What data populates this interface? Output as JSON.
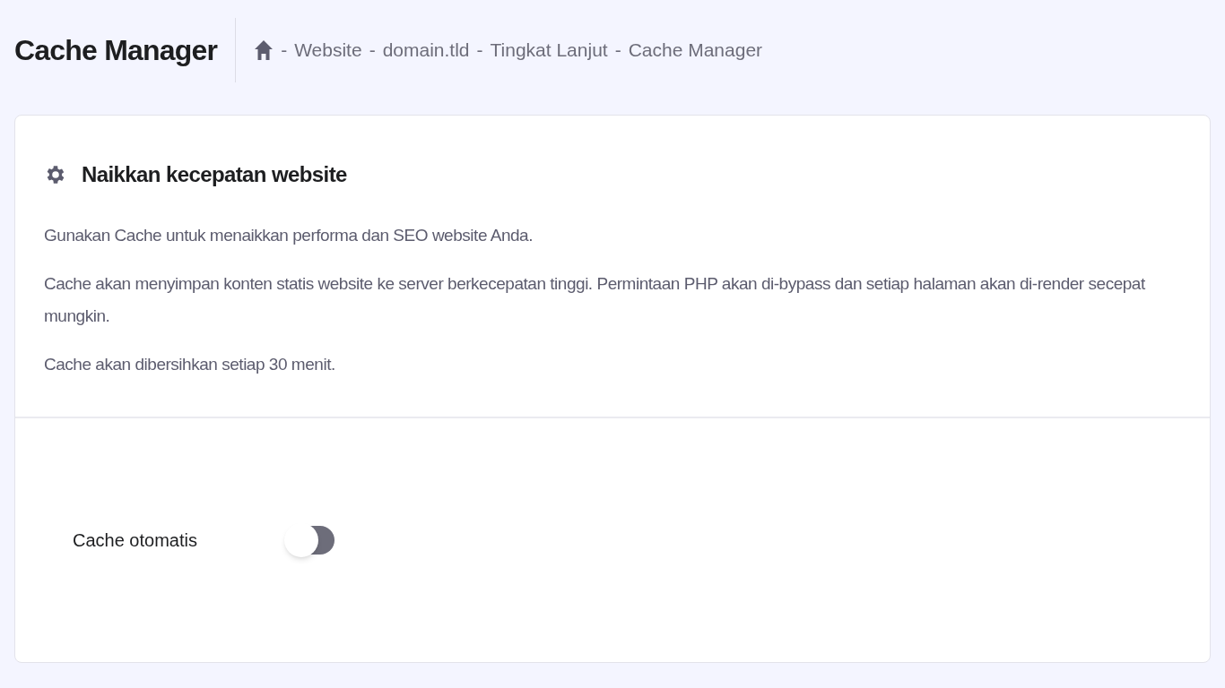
{
  "page": {
    "title": "Cache Manager"
  },
  "breadcrumb": {
    "separator": "-",
    "items": [
      "Website",
      "domain.tld",
      "Tingkat Lanjut",
      "Cache Manager"
    ]
  },
  "card": {
    "title": "Naikkan kecepatan website",
    "paragraphs": [
      "Gunakan Cache untuk menaikkan performa dan SEO website Anda.",
      "Cache akan menyimpan konten statis website ke server berkecepatan tinggi. Permintaan PHP akan di-bypass dan setiap halaman akan di-render secepat mungkin.",
      "Cache akan dibersihkan setiap 30 menit."
    ]
  },
  "settings": [
    {
      "kind": "toggle",
      "label": "Cache otomatis",
      "on": false
    }
  ]
}
